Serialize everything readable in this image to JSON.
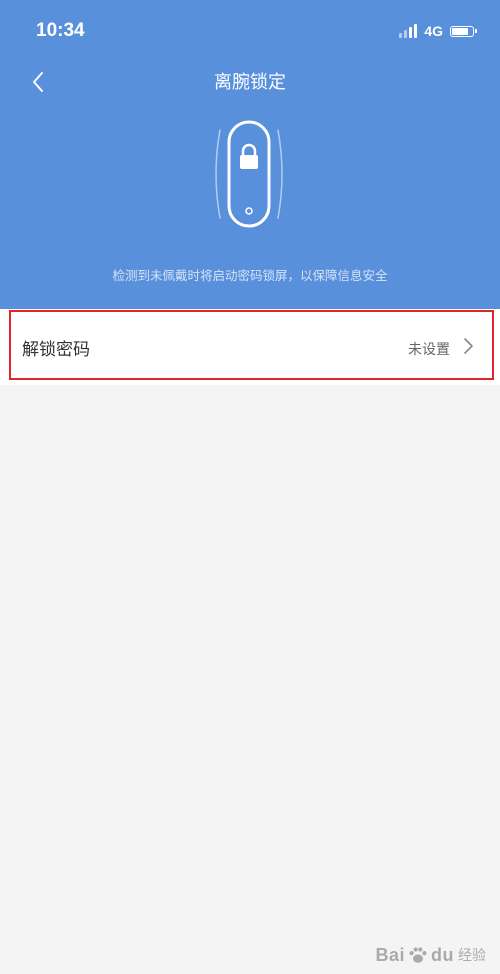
{
  "status_bar": {
    "time": "10:34",
    "network": "4G",
    "icons": [
      "signal-icon",
      "battery-icon"
    ]
  },
  "header": {
    "title": "离腕锁定",
    "back_icon": "chevron-left-icon",
    "illustration_icon": "band-lock-icon",
    "description": "检测到未佩戴时将启动密码锁屏，以保障信息安全"
  },
  "settings": {
    "items": [
      {
        "label": "解锁密码",
        "value": "未设置",
        "icon": "chevron-right-icon"
      }
    ]
  },
  "watermark": {
    "brand_a": "Bai",
    "brand_b": "du",
    "suffix": "经验"
  },
  "colors": {
    "header_bg": "#5890dc",
    "page_bg": "#f4f4f4",
    "highlight_border": "#e0262a"
  }
}
